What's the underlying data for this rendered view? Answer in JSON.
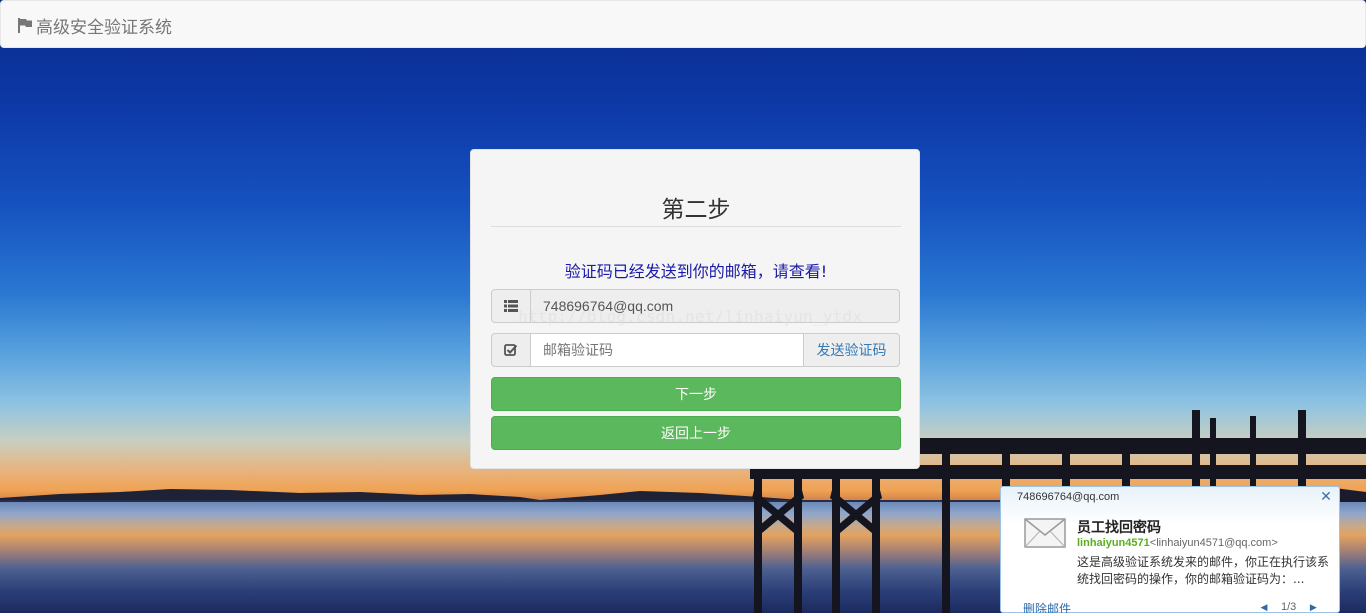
{
  "navbar": {
    "brand_text": "高级安全验证系统",
    "brand_icon": "flag-icon"
  },
  "card": {
    "title": "第二步",
    "message": "验证码已经发送到你的邮箱，请查看!",
    "email_field": {
      "value": "748696764@qq.com",
      "icon": "list-icon"
    },
    "code_field": {
      "placeholder": "邮箱验证码",
      "value": "",
      "icon": "checkbox-icon",
      "send_button": "发送验证码"
    },
    "next_button": "下一步",
    "back_button": "返回上一步"
  },
  "watermark": "http://blog.csdn.net/linhaiyun_ytdx",
  "mail_popup": {
    "account": "748696764@qq.com",
    "subject": "员工找回密码",
    "sender_name": "linhaiyun4571",
    "sender_address": "<linhaiyun4571@qq.com>",
    "body": "这是高级验证系统发来的邮件，你正在执行该系统找回密码的操作，你的邮箱验证码为：...",
    "delete_label": "删除邮件",
    "page_indicator": "1/3",
    "close_icon": "close-icon",
    "envelope_icon": "envelope-icon"
  },
  "colors": {
    "success": "#5cb85c",
    "link": "#337ab7",
    "message": "#1a1aa8",
    "sender": "#5cae1f"
  }
}
